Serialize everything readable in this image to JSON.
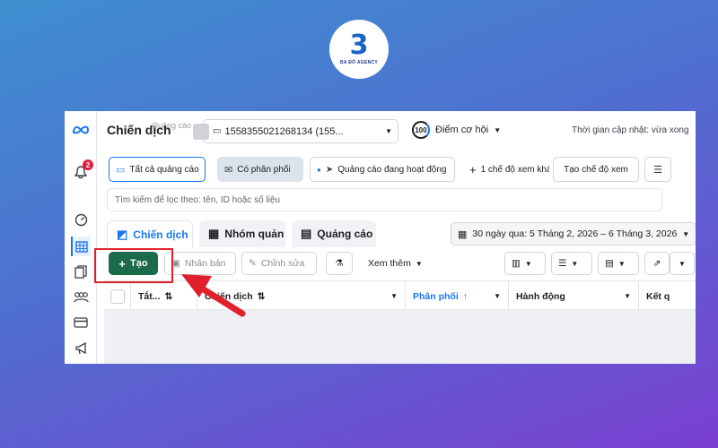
{
  "logo": {
    "mark": "3",
    "brand": "BA ĐÔ AGENCY"
  },
  "topbar": {
    "title": "Chiến dịch",
    "ghost": "Quảng cáo",
    "account_id": "1558355021268134 (155...",
    "score_value": "100",
    "score_label": "Điểm cơ hội",
    "updated": "Thời gian cập nhật: vừa xong"
  },
  "nav": {
    "notification_count": "2"
  },
  "filters": {
    "all_ads": "Tất cả quảng cáo",
    "has_delivery": "Có phân phối",
    "active_ads": "Quảng cáo đang hoạt động",
    "more_views": "1 chế độ xem khá",
    "create_view": "Tạo chế độ xem"
  },
  "search": {
    "placeholder": "Tìm kiếm để lọc theo: tên, ID hoặc số liệu"
  },
  "tabs": [
    {
      "label": "Chiến dịch"
    },
    {
      "label": "Nhóm quản"
    },
    {
      "label": "Quảng cáo"
    }
  ],
  "date_range": "30 ngày qua: 5 Tháng 2, 2026 – 6 Tháng 3, 2026",
  "toolbar": {
    "create": "Tạo",
    "duplicate": "Nhân bản",
    "edit": "Chỉnh sửa",
    "see_more": "Xem thêm"
  },
  "table": {
    "headers": [
      "Tắt...",
      "Chiến dịch",
      "Phân phối",
      "Hành động",
      "Kết q"
    ]
  },
  "colors": {
    "accent": "#1877f2",
    "create_button": "#1b6a49",
    "highlight": "#e0202a"
  }
}
